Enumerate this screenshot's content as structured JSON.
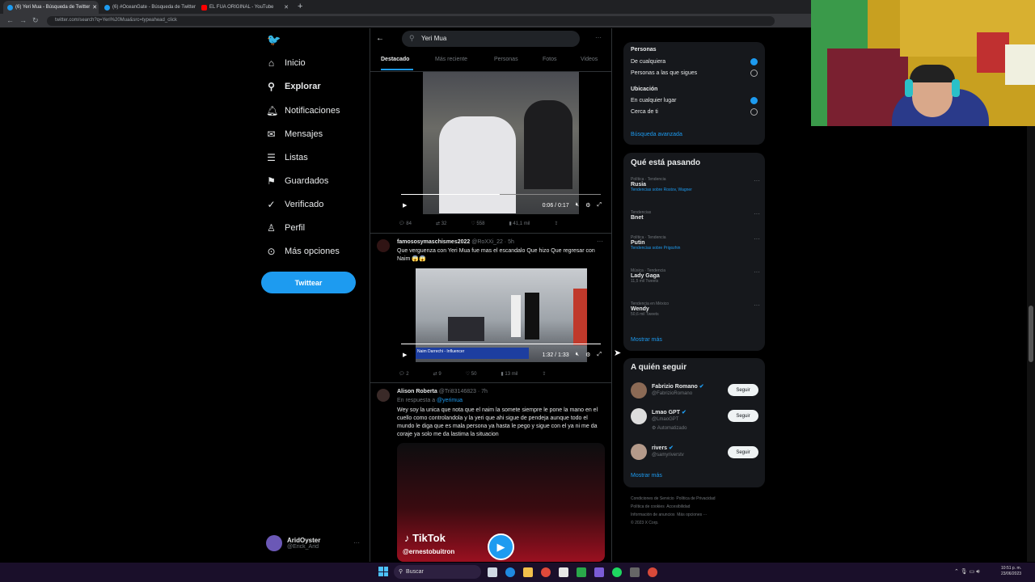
{
  "browser": {
    "tabs": [
      {
        "title": "(6) Yeri Mua - Búsqueda de Twitter",
        "active": true,
        "icon": "twitter-icon"
      },
      {
        "title": "(6) #OceanGate - Búsqueda de Twitter",
        "active": false,
        "icon": "twitter-icon"
      },
      {
        "title": "EL FUA ORIGINAL - YouTube",
        "active": false,
        "icon": "youtube-icon"
      }
    ],
    "new_tab": "+",
    "url": "twitter.com/search?q=Yeri%20Mua&src=typeahead_click"
  },
  "sidebar": {
    "items": [
      {
        "label": "Inicio",
        "icon": "home-icon"
      },
      {
        "label": "Explorar",
        "icon": "search-icon"
      },
      {
        "label": "Notificaciones",
        "icon": "bell-icon"
      },
      {
        "label": "Mensajes",
        "icon": "mail-icon"
      },
      {
        "label": "Listas",
        "icon": "list-icon"
      },
      {
        "label": "Guardados",
        "icon": "bookmark-icon"
      },
      {
        "label": "Verificado",
        "icon": "verified-icon"
      },
      {
        "label": "Perfil",
        "icon": "person-icon"
      },
      {
        "label": "Más opciones",
        "icon": "more-icon"
      }
    ],
    "tweet_button": "Twittear",
    "account": {
      "name": "AridOyster",
      "handle": "@Erick_Arid"
    }
  },
  "search": {
    "query": "Yeri Mua",
    "tabs": [
      "Destacado",
      "Más reciente",
      "Personas",
      "Fotos",
      "Videos"
    ]
  },
  "tweets": [
    {
      "time": "0:06 / 0:17",
      "stats": [
        "84",
        "32",
        "558",
        "41,1 mil"
      ]
    },
    {
      "author": "famososymaschismes2022",
      "handle": "@RoXXi_22 · 5h",
      "text": "Que verguenza con Yeri Mua fue mas el escandalo Que hizo Que regresar con Naim 😱😱",
      "caption": "Naim Darrechi - Influencer",
      "time": "1:32 / 1:33",
      "stats": [
        "2",
        "9",
        "50",
        "13 mil"
      ]
    },
    {
      "author": "Alison Roberta",
      "handle": "@Tri83146823 · 7h",
      "reply_prefix": "En respuesta a ",
      "reply_to": "@yerimua",
      "text": "Wey soy la unica que nota que el naim la somete siempre le pone la mano en el cuello como controlandola y la yeri que ahi sigue de pendeja aunque todo el mundo le diga que es mala persona ya hasta le pego y sigue con el ya ni me da coraje ya solo me da lastima la situacion",
      "tiktok": "TikTok",
      "tiktok_user": "@ernestobuitron"
    }
  ],
  "filters": {
    "people_title": "Personas",
    "people_options": [
      "De cualquiera",
      "Personas a las que sigues"
    ],
    "location_title": "Ubicación",
    "location_options": [
      "En cualquier lugar",
      "Cerca de ti"
    ],
    "advanced": "Búsqueda avanzada"
  },
  "trends": {
    "title": "Qué está pasando",
    "items": [
      {
        "meta": "Política · Tendencia",
        "name": "Rusia",
        "extra": "Tendencias sobre Rostov, Wagner"
      },
      {
        "meta": "Tendencias",
        "name": "Bnet",
        "extra": ""
      },
      {
        "meta": "Política · Tendencia",
        "name": "Putin",
        "extra": "Tendencias sobre Prigozhin"
      },
      {
        "meta": "Música · Tendencia",
        "name": "Lady Gaga",
        "extra": "11,5 mil Tweets"
      },
      {
        "meta": "Tendencia en México",
        "name": "Wendy",
        "extra": "50,6 mil Tweets"
      }
    ],
    "more": "Mostrar más"
  },
  "who_to_follow": {
    "title": "A quién seguir",
    "users": [
      {
        "name": "Fabrizio Romano",
        "handle": "@FabrizioRomano",
        "note": ""
      },
      {
        "name": "Lmao GPT",
        "handle": "@LmaoGPT",
        "note": "Automatizado"
      },
      {
        "name": "rivers",
        "handle": "@samyriverstv",
        "note": ""
      }
    ],
    "button": "Seguir",
    "more": "Mostrar más"
  },
  "footer": [
    "Condiciones de Servicio",
    "Política de Privacidad",
    "Política de cookies",
    "Accesibilidad",
    "Información de anuncios",
    "Más opciones ···",
    "© 2023 X Corp."
  ],
  "taskbar": {
    "search": "Buscar",
    "time": "10:51 p. m.",
    "date": "23/06/2023"
  }
}
